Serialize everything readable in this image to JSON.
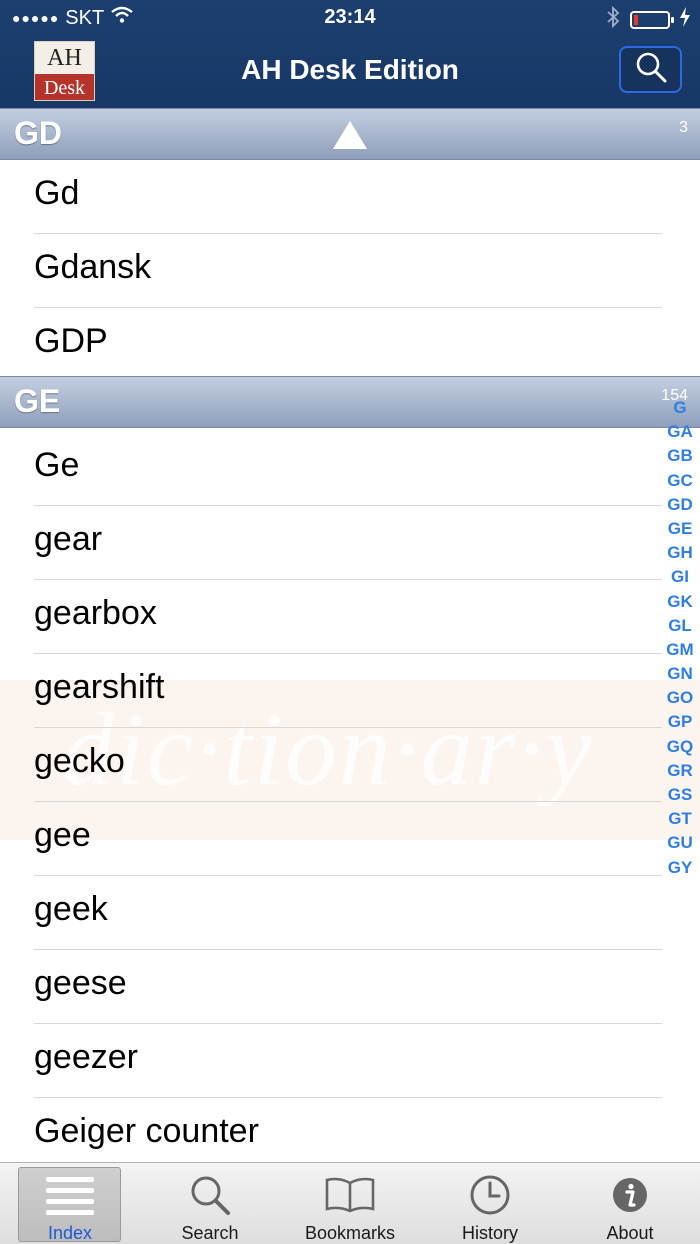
{
  "status_bar": {
    "carrier": "SKT",
    "time": "23:14",
    "signal_dots": "●●●●●"
  },
  "navbar": {
    "title": "AH Desk Edition",
    "logo_top": "AH",
    "logo_bottom": "Desk"
  },
  "sections": [
    {
      "label": "GD",
      "count": "3",
      "items": [
        "Gd",
        "Gdansk",
        "GDP"
      ]
    },
    {
      "label": "GE",
      "count": "154",
      "items": [
        "Ge",
        "gear",
        "gearbox",
        "gearshift",
        "gecko",
        "gee",
        "geek",
        "geese",
        "geezer",
        "Geiger counter"
      ]
    }
  ],
  "watermark": "dic·tion·ar·y",
  "section_index": [
    "G",
    "GA",
    "GB",
    "GC",
    "GD",
    "GE",
    "GH",
    "GI",
    "GK",
    "GL",
    "GM",
    "GN",
    "GO",
    "GP",
    "GQ",
    "GR",
    "GS",
    "GT",
    "GU",
    "GY"
  ],
  "tabs": [
    {
      "label": "Index",
      "icon": "list-icon",
      "active": true
    },
    {
      "label": "Search",
      "icon": "search-icon",
      "active": false
    },
    {
      "label": "Bookmarks",
      "icon": "book-icon",
      "active": false
    },
    {
      "label": "History",
      "icon": "clock-icon",
      "active": false
    },
    {
      "label": "About",
      "icon": "info-icon",
      "active": false
    }
  ],
  "colors": {
    "nav_bg": "#1d3f70",
    "index_blue": "#2e7ee6",
    "active_tab_label": "#1e58d8",
    "section_header": "#a9b6cc"
  }
}
